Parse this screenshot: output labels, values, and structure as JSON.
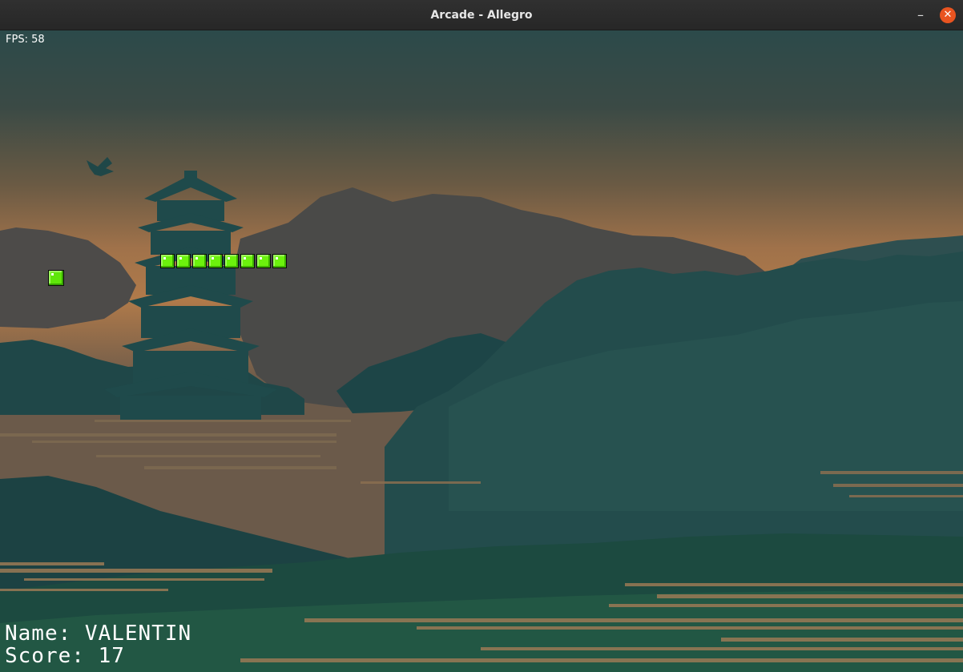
{
  "window": {
    "title": "Arcade - Allegro",
    "minimize_glyph": "–",
    "close_glyph": "✕",
    "close_color": "#e95420"
  },
  "game": {
    "fps_text": "FPS: 58",
    "player_name_text": "Name: VALENTIN",
    "score_text": "Score: 17",
    "snake_color": "#6cf20d",
    "snake_length": 8,
    "background": "pixel-art sunset scene with pagoda, clouds, bird and misty forest hills"
  }
}
